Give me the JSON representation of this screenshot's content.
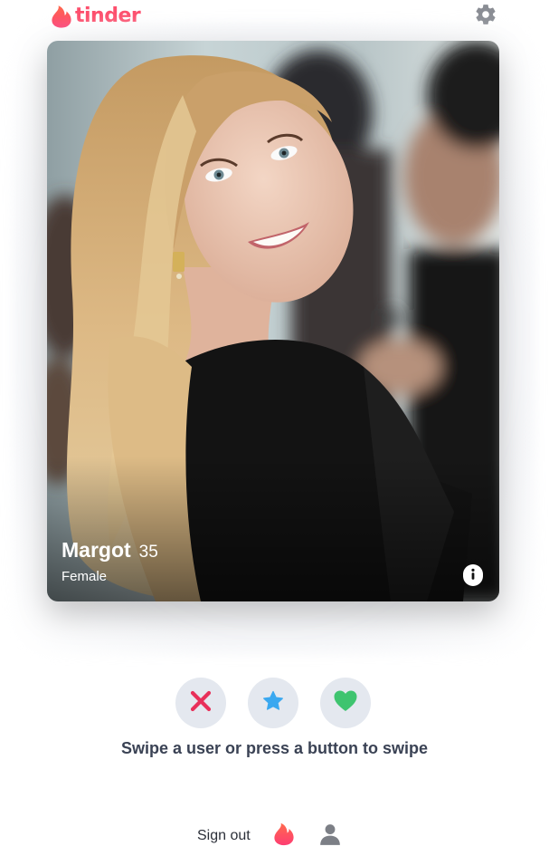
{
  "header": {
    "brand": "tinder",
    "logo_icon": "flame-icon",
    "settings_icon": "gear-icon"
  },
  "card": {
    "name": "Margot",
    "age": "35",
    "gender": "Female",
    "info_icon": "info-icon",
    "photo_icon": "profile-photo"
  },
  "actions": [
    {
      "name": "nope",
      "icon": "x-icon",
      "color": "#e8305a"
    },
    {
      "name": "super-like",
      "icon": "star-icon",
      "color": "#3aa8f0"
    },
    {
      "name": "like",
      "icon": "heart-icon",
      "color": "#3ec46f"
    }
  ],
  "hint": "Swipe a user or press a button to swipe",
  "footer": {
    "signout": "Sign out",
    "swipe_icon": "flame-icon",
    "profile_icon": "user-icon"
  },
  "colors": {
    "brand": "#fd4f6d",
    "button_bg": "#e4e8ef",
    "hint_text": "#3a4254"
  }
}
